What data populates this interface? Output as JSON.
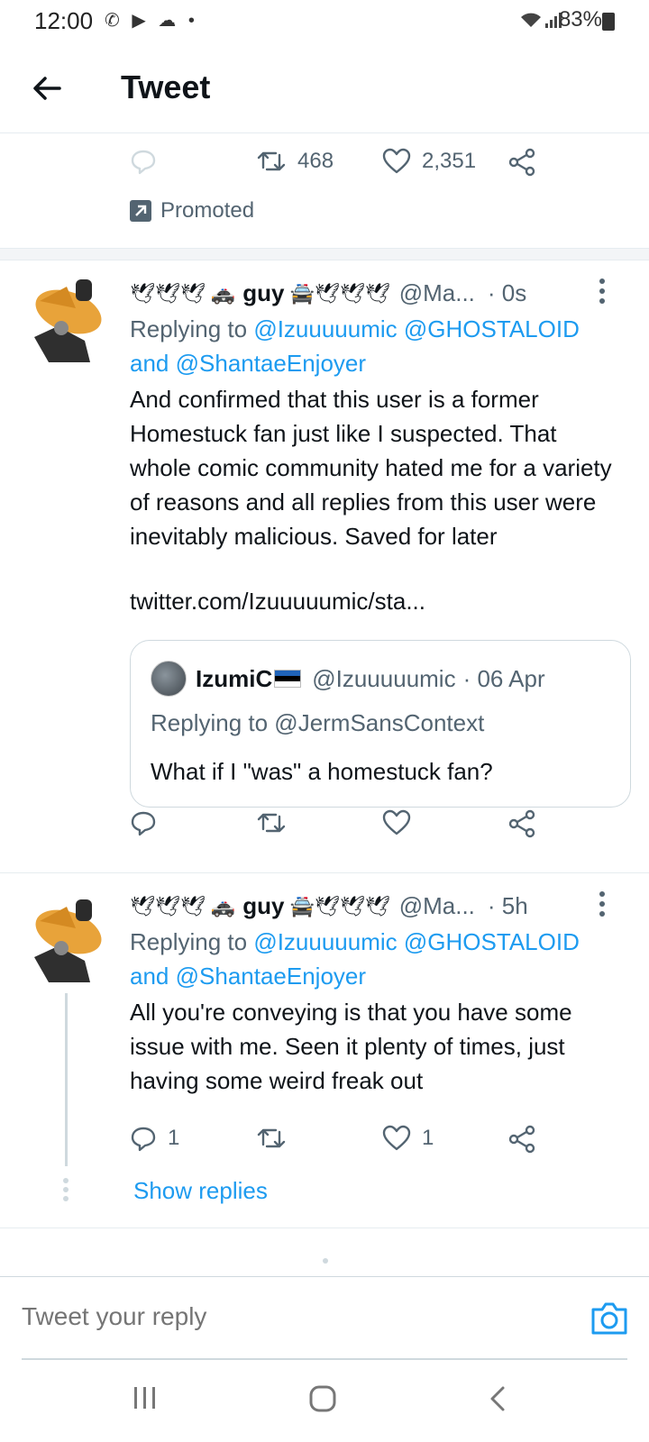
{
  "status_bar": {
    "time": "12:00",
    "battery": "83%",
    "left_icons": [
      "missed-call-icon",
      "youtube-icon",
      "cloud-icon",
      "dot-icon"
    ],
    "right_icons": [
      "wifi-icon",
      "signal-icon",
      "battery-icon"
    ]
  },
  "header": {
    "title": "Tweet"
  },
  "promoted_tweet": {
    "retweets": "468",
    "likes": "2,351",
    "promoted_label": "Promoted"
  },
  "tweets": [
    {
      "display_name": "guy",
      "name_emojis_before": "🕊🕊🕊 🚓",
      "name_emojis_after": "🚔🕊🕊🕊",
      "handle": "@Ma...",
      "time": "· 0s",
      "replying_to_prefix": "Replying to",
      "replying_to_user1": "@Izuuuuumic",
      "replying_to_user2": "@GHOSTALOID",
      "replying_to_and": "and",
      "replying_to_user3": "@ShantaeEnjoyer",
      "text": "And confirmed that this user is a former Homestuck fan just like I suspected. That whole comic community hated me for a variety of reasons and all replies from this user were inevitably malicious. Saved for later",
      "link": "twitter.com/Izuuuuumic/sta...",
      "quote": {
        "name": "IzumiC",
        "handle": "@Izuuuuumic",
        "time": "· 06 Apr",
        "replying_to": "Replying to @JermSansContext",
        "text": "What if I \"was\" a homestuck fan?"
      }
    },
    {
      "display_name": "guy",
      "name_emojis_before": "🕊🕊🕊 🚓",
      "name_emojis_after": "🚔🕊🕊🕊",
      "handle": "@Ma...",
      "time": "· 5h",
      "replying_to_prefix": "Replying to",
      "replying_to_user1": "@Izuuuuumic",
      "replying_to_user2": "@GHOSTALOID",
      "replying_to_and": "and",
      "replying_to_user3": "@ShantaeEnjoyer",
      "text": "All you're conveying is that you have some issue with me. Seen it plenty of times, just having some weird freak out",
      "reply_count": "1",
      "like_count": "1",
      "show_replies": "Show replies"
    }
  ],
  "reply_bar": {
    "placeholder": "Tweet your reply"
  },
  "colors": {
    "accent": "#1d9bf0",
    "muted": "#536471",
    "text": "#0f1419",
    "border": "#cfd9de"
  }
}
